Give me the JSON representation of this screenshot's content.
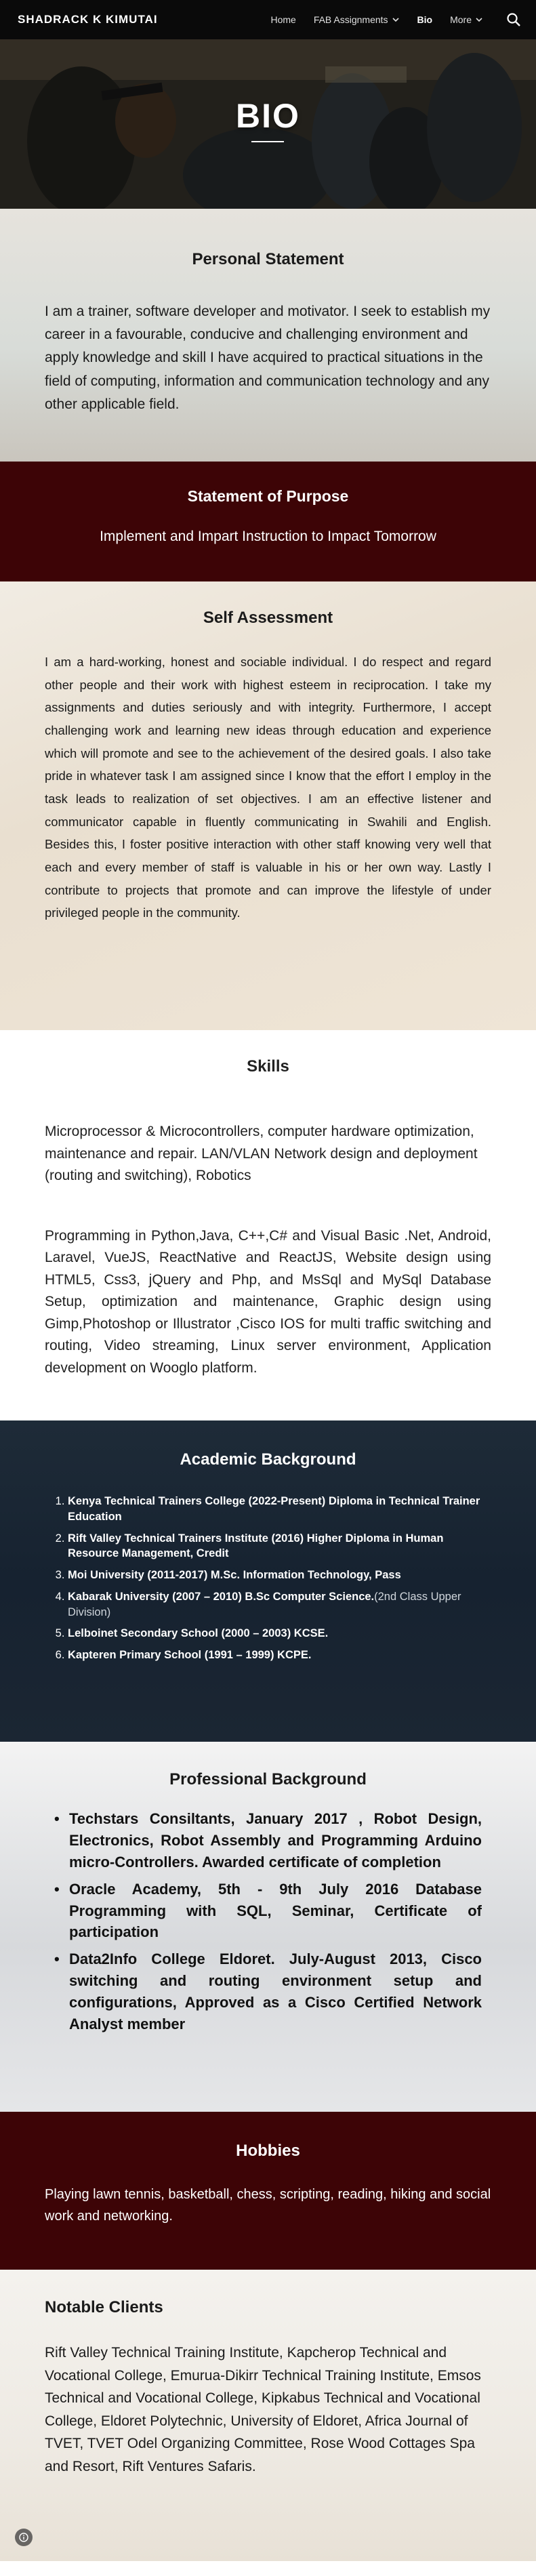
{
  "header": {
    "site_title": "SHADRACK K KIMUTAI",
    "nav": [
      {
        "label": "Home",
        "has_dropdown": false,
        "active": false
      },
      {
        "label": "FAB Assignments",
        "has_dropdown": true,
        "active": false
      },
      {
        "label": "Bio",
        "has_dropdown": false,
        "active": true
      },
      {
        "label": "More",
        "has_dropdown": true,
        "active": false
      }
    ],
    "search_icon": "search-icon"
  },
  "hero": {
    "title": "BIO"
  },
  "personal_statement": {
    "title": "Personal Statement",
    "text": "I am a trainer, software developer and motivator. I seek to establish my career in a favourable, conducive and challenging environment and apply knowledge and skill I have acquired to practical situations in the field of computing, information and communication technology and any other applicable field."
  },
  "statement_of_purpose": {
    "title": "Statement of Purpose",
    "text": "Implement and Impart Instruction to Impact Tomorrow"
  },
  "self_assessment": {
    "title": "Self Assessment",
    "text": "I am a hard-working, honest and sociable individual. I do respect and regard other people and their work with highest esteem in reciprocation. I take my assignments and duties seriously and with integrity. Furthermore, I  accept challenging work and learning new ideas through education and experience which will promote and see to the achievement of the desired goals. I  also take pride in whatever task I am assigned  since I know that the effort I employ in the task leads to realization of set objectives. I am an effective listener and communicator capable in fluently communicating in Swahili and English. Besides this, I  foster positive interaction with other staff knowing very well that each and every member of staff is valuable in his or her own way. Lastly I  contribute to projects that promote and can improve the lifestyle of under privileged people in the community."
  },
  "skills": {
    "title": "Skills",
    "paragraphs": [
      "Microprocessor & Microcontrollers, computer hardware optimization, maintenance and repair. LAN/VLAN Network design and deployment (routing and switching), Robotics",
      "Programming in Python,Java, C++,C# and Visual Basic .Net, Android, Laravel, VueJS, ReactNative and ReactJS, Website design using HTML5, Css3, jQuery and Php, and MsSql and MySql Database Setup, optimization and maintenance, Graphic design using Gimp,Photoshop or Illustrator ,Cisco IOS for multi traffic switching and routing, Video streaming, Linux server environment, Application development on Wooglo platform."
    ]
  },
  "academic": {
    "title": "Academic Background",
    "items": [
      {
        "main": "Kenya Technical Trainers College (2022-Present) Diploma in Technical Trainer Education",
        "note": ""
      },
      {
        "main": "Rift Valley Technical Trainers Institute (2016) Higher Diploma in Human Resource Management, Credit",
        "note": ""
      },
      {
        "main": "Moi University (2011-2017) M.Sc. Information Technology, Pass",
        "note": ""
      },
      {
        "main": "Kabarak University (2007 – 2010) B.Sc Computer Science.",
        "note": "(2nd Class  Upper Division)"
      },
      {
        "main": "Lelboinet Secondary School  (2000 – 2003) KCSE.",
        "note": ""
      },
      {
        "main": "Kapteren Primary School  (1991 – 1999) KCPE.",
        "note": ""
      }
    ]
  },
  "professional": {
    "title": "Professional Background",
    "items": [
      "Techstars Consiltants, January 2017 , Robot Design, Electronics, Robot Assembly and Programming Arduino micro-Controllers.  Awarded certificate of completion",
      "Oracle Academy, 5th - 9th July 2016  Database Programming with SQL, Seminar, Certificate of participation",
      "Data2Info College Eldoret. July-August 2013, Cisco switching and routing environment setup and configurations, Approved as a  Cisco Certified Network Analyst member"
    ]
  },
  "hobbies": {
    "title": "Hobbies",
    "text": "Playing lawn tennis, basketball, chess, scripting, reading, hiking and social work and networking."
  },
  "clients": {
    "title": "Notable Clients",
    "text": "Rift Valley Technical Training Institute, Kapcherop Technical and Vocational College, Emurua-Dikirr Technical Training Institute, Emsos Technical and Vocational College, Kipkabus Technical and Vocational College, Eldoret Polytechnic, University of Eldoret, Africa Journal of TVET, TVET Odel Organizing Committee, Rose Wood Cottages Spa and Resort, Rift Ventures Safaris."
  },
  "footer": {
    "info_icon": "info-icon"
  }
}
